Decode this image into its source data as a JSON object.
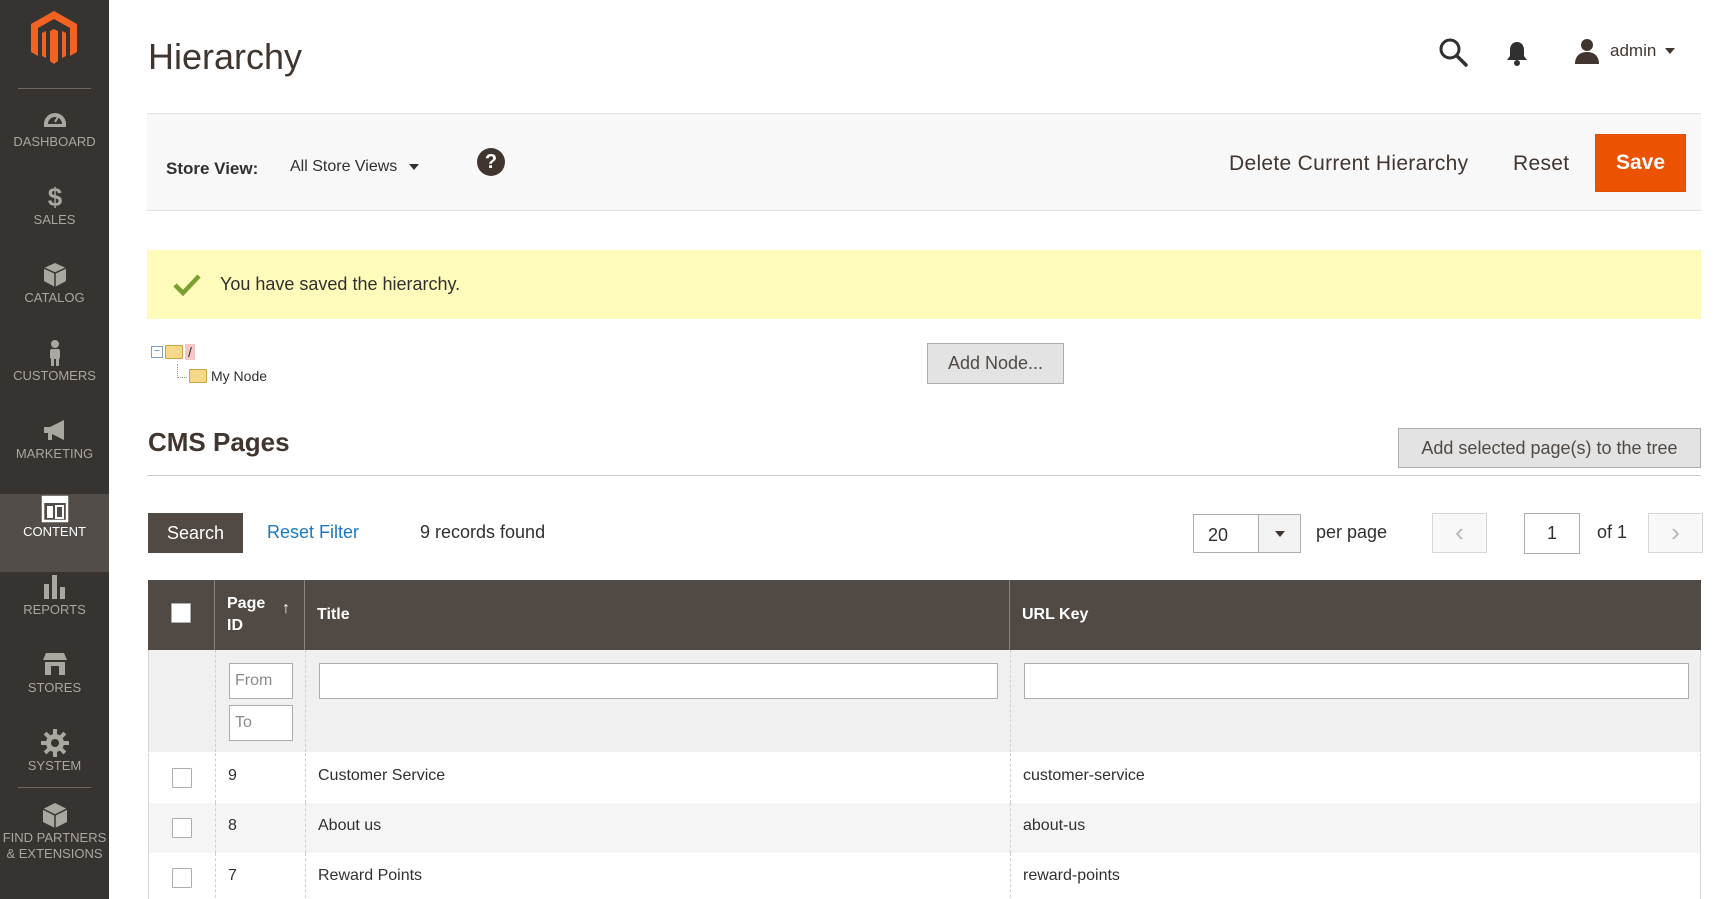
{
  "page": {
    "title": "Hierarchy"
  },
  "header": {
    "user_name": "admin"
  },
  "sidebar": {
    "items": [
      {
        "label": "DASHBOARD",
        "icon": "dashboard-icon"
      },
      {
        "label": "SALES",
        "icon": "dollar-icon"
      },
      {
        "label": "CATALOG",
        "icon": "box-icon"
      },
      {
        "label": "CUSTOMERS",
        "icon": "person-icon"
      },
      {
        "label": "MARKETING",
        "icon": "megaphone-icon"
      },
      {
        "label": "CONTENT",
        "icon": "layout-icon"
      },
      {
        "label": "REPORTS",
        "icon": "bar-chart-icon"
      },
      {
        "label": "STORES",
        "icon": "storefront-icon"
      },
      {
        "label": "SYSTEM",
        "icon": "gear-icon"
      },
      {
        "label_line1": "FIND PARTNERS",
        "label_line2": "& EXTENSIONS",
        "icon": "partners-icon"
      }
    ],
    "active": "CONTENT"
  },
  "actions": {
    "store_view_label": "Store View:",
    "store_view_value": "All Store Views",
    "help": "?",
    "delete_label": "Delete Current Hierarchy",
    "reset_label": "Reset",
    "save_label": "Save"
  },
  "message": {
    "text": "You have saved the hierarchy."
  },
  "tree": {
    "root": "/",
    "children": [
      "My Node"
    ],
    "add_node_label": "Add Node..."
  },
  "cms": {
    "title": "CMS Pages",
    "add_selected_label": "Add selected page(s) to the tree",
    "search_label": "Search",
    "reset_filter_label": "Reset Filter",
    "records_found": "9 records found",
    "per_page_value": "20",
    "per_page_label": "per page",
    "prev": "‹",
    "next": "›",
    "page_current": "1",
    "page_of": "of 1",
    "columns": {
      "page_id_line1": "Page",
      "page_id_line2": "ID",
      "sort_arrow": "↑",
      "title": "Title",
      "url_key": "URL Key"
    },
    "filters": {
      "from_placeholder": "From",
      "to_placeholder": "To"
    },
    "rows": [
      {
        "id": "9",
        "title": "Customer Service",
        "url_key": "customer-service"
      },
      {
        "id": "8",
        "title": "About us",
        "url_key": "about-us"
      },
      {
        "id": "7",
        "title": "Reward Points",
        "url_key": "reward-points"
      }
    ]
  },
  "colors": {
    "sidebar_bg": "#373330",
    "sidebar_active": "#524d49",
    "accent_orange": "#eb5202",
    "grid_header": "#514943",
    "link_blue": "#1979c3",
    "message_bg": "#fffbbb",
    "success_green": "#79a22e"
  }
}
